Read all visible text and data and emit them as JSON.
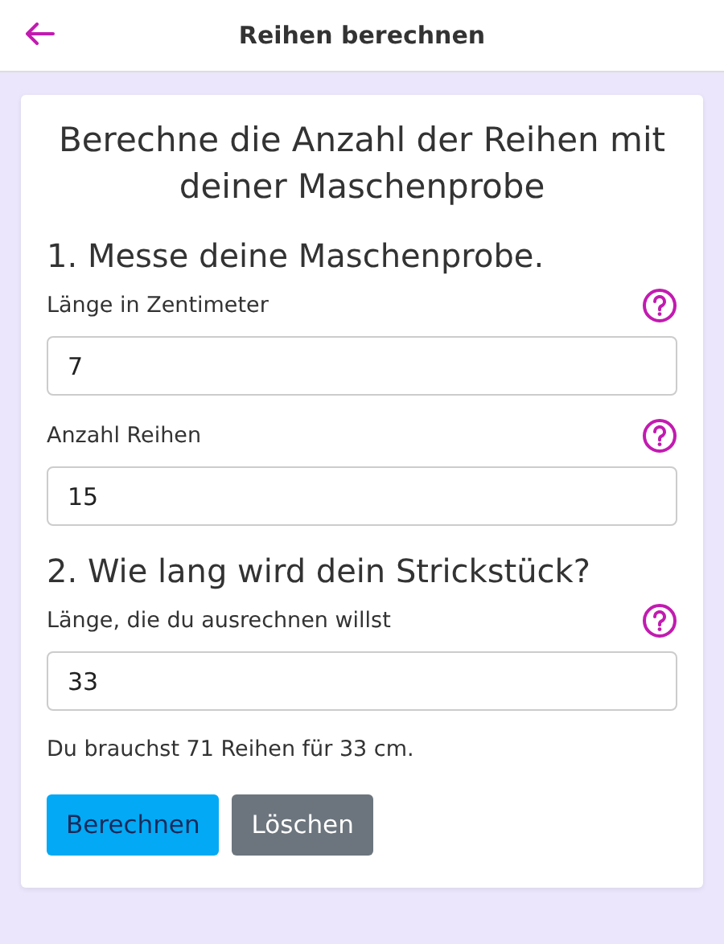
{
  "header": {
    "title": "Reihen berechnen"
  },
  "card": {
    "title": "Berechne die Anzahl der Reihen mit deiner Maschenprobe",
    "sections": [
      {
        "heading": "1. Messe deine Maschenprobe.",
        "fields": [
          {
            "label": "Länge in Zentimeter",
            "value": "7"
          },
          {
            "label": "Anzahl Reihen",
            "value": "15"
          }
        ]
      },
      {
        "heading": "2. Wie lang wird dein Strickstück?",
        "fields": [
          {
            "label": "Länge, die du ausrechnen willst",
            "value": "33"
          }
        ]
      }
    ],
    "result": "Du brauchst 71 Reihen für 33 cm.",
    "buttons": [
      {
        "label": "Berechnen",
        "kind": "primary"
      },
      {
        "label": "Löschen",
        "kind": "secondary"
      }
    ]
  }
}
